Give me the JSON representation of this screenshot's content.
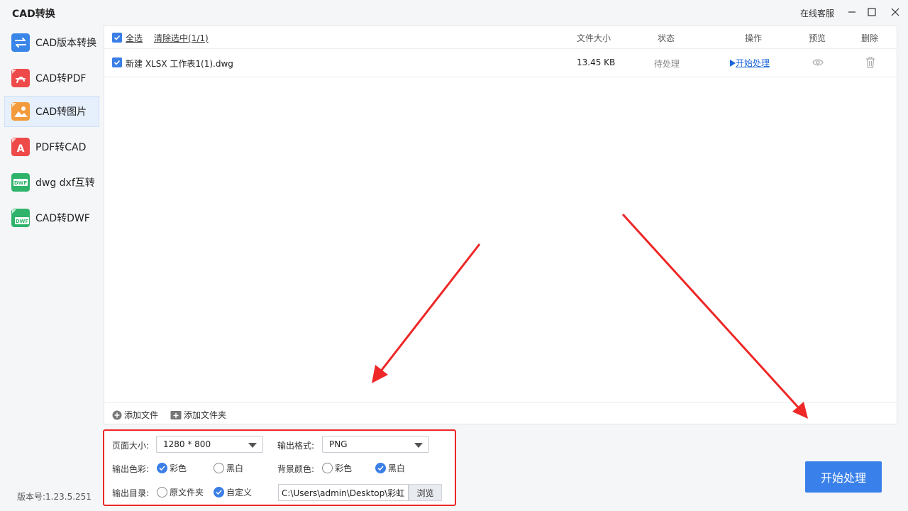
{
  "app": {
    "title": "CAD转换",
    "online_service": "在线客服",
    "version": "版本号:1.23.5.251"
  },
  "colors": {
    "accent": "#3a7ee6",
    "highlight_border": "#ee2727",
    "active_nav_bg": "#e6effc"
  },
  "sidebar": {
    "items": [
      {
        "label": "CAD版本转换",
        "icon": "version-convert-icon",
        "active": false
      },
      {
        "label": "CAD转PDF",
        "icon": "pdf-icon",
        "active": false
      },
      {
        "label": "CAD转图片",
        "icon": "image-icon",
        "active": true
      },
      {
        "label": "PDF转CAD",
        "icon": "pdf-to-cad-icon",
        "active": false
      },
      {
        "label": "dwg dxf互转",
        "icon": "dwf-icon",
        "active": false
      },
      {
        "label": "CAD转DWF",
        "icon": "dwf-icon",
        "active": false
      }
    ]
  },
  "file_list": {
    "select_all": "全选",
    "clear_selection": "清除选中(1/1)",
    "columns": {
      "size": "文件大小",
      "status": "状态",
      "action": "操作",
      "preview": "预览",
      "delete": "删除"
    },
    "rows": [
      {
        "name": "新建 XLSX 工作表1(1).dwg",
        "size": "13.45 KB",
        "status": "待处理",
        "action": "开始处理"
      }
    ],
    "add_file": "添加文件",
    "add_folder": "添加文件夹"
  },
  "settings": {
    "page_size_label": "页面大小:",
    "page_size_value": "1280 * 800",
    "format_label": "输出格式:",
    "format_value": "PNG",
    "color_label": "输出色彩:",
    "color_options": [
      "彩色",
      "黑白"
    ],
    "color_selected": "彩色",
    "bg_label": "背景颜色:",
    "bg_options": [
      "彩色",
      "黑白"
    ],
    "bg_selected": "黑白",
    "dir_label": "输出目录:",
    "dir_options": [
      "原文件夹",
      "自定义"
    ],
    "dir_selected": "自定义",
    "dir_path": "C:\\Users\\admin\\Desktop\\彩虹",
    "browse": "浏览"
  },
  "start_button": "开始处理"
}
